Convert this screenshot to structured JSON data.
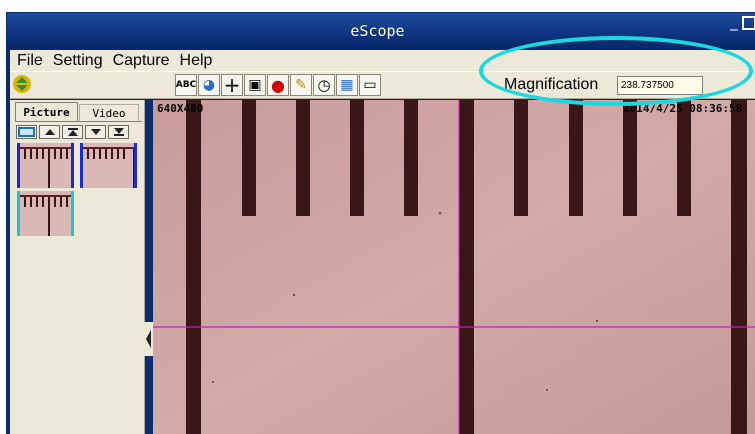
{
  "window": {
    "title": "eScope",
    "controls": [
      "_",
      "□",
      "×"
    ]
  },
  "menu": [
    "File",
    "Setting",
    "Capture",
    "Help"
  ],
  "toolbar": {
    "tools": [
      {
        "icon": "abc-text-icon",
        "glyph": "ABC"
      },
      {
        "icon": "globe-icon",
        "glyph": "◕"
      },
      {
        "icon": "crosshair-icon",
        "glyph": "+"
      },
      {
        "icon": "camera-icon",
        "glyph": "▣"
      },
      {
        "icon": "record-icon",
        "glyph": "●"
      },
      {
        "icon": "brush-icon",
        "glyph": "✎"
      },
      {
        "icon": "clock-icon",
        "glyph": "◷"
      },
      {
        "icon": "calendar-icon",
        "glyph": "▦"
      },
      {
        "icon": "save-icon",
        "glyph": "▭"
      }
    ],
    "magnification_label": "Magnification",
    "magnification_value": "238.737500"
  },
  "side_panel": {
    "tabs": [
      "Picture",
      "Video"
    ],
    "thumb_controls": [
      "thumbnail-view-icon",
      "up-icon",
      "top-icon",
      "down-icon",
      "bottom-icon"
    ]
  },
  "image": {
    "resolution": "640X480",
    "datetime": "2014/4/25 08:36:58",
    "colors": {
      "background": "#cfa5a4",
      "ticks": "#3a1414",
      "crosshair": "#c61ec6",
      "highlight": "#18d8e0"
    }
  }
}
